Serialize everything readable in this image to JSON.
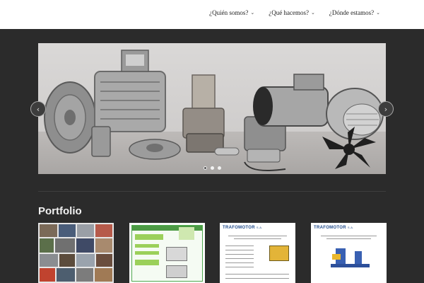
{
  "nav": {
    "items": [
      {
        "label": "¿Quién somos?"
      },
      {
        "label": "¿Qué hacemos?"
      },
      {
        "label": "¿Dónde estamos?"
      }
    ]
  },
  "slider": {
    "prev_icon": "‹",
    "next_icon": "›",
    "dot_count": 3,
    "active_dot": 1
  },
  "portfolio": {
    "title": "Portfolio",
    "thumbs": [
      {
        "brand": ""
      },
      {
        "brand": ""
      },
      {
        "brand": "TRAFOMOTOR",
        "brand_suffix": "S.A."
      },
      {
        "brand": "TRAFOMOTOR",
        "brand_suffix": "S.A."
      }
    ]
  },
  "colors": {
    "page_background": "#2b2b2b",
    "header_background": "#ffffff",
    "brand_blue": "#1f4a8a"
  }
}
